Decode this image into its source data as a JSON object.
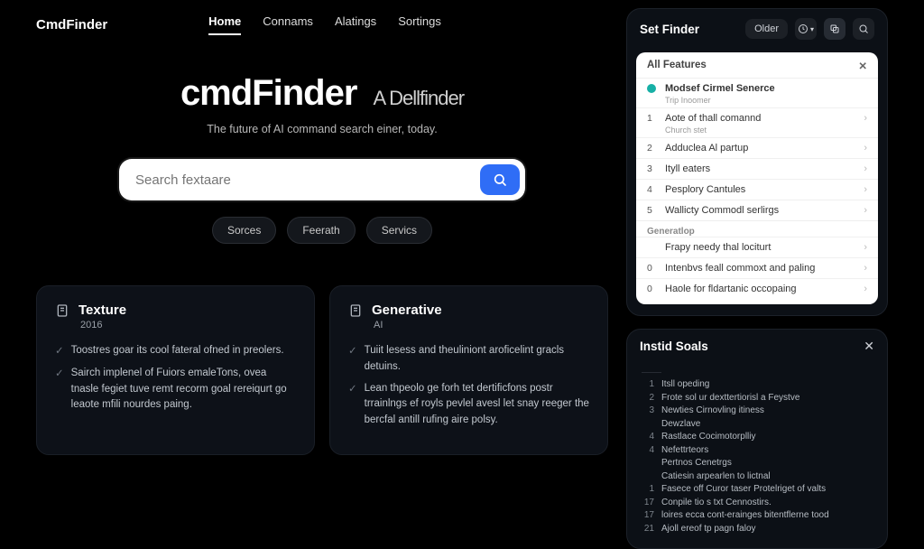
{
  "brand": "CmdFinder",
  "nav": {
    "items": [
      "Home",
      "Connams",
      "Alatings",
      "Sortings"
    ],
    "activeIndex": 0
  },
  "hero": {
    "title_main": "cmdFinder",
    "title_sub": "A Dellfinder",
    "tagline": "The future of AI command search einer, today."
  },
  "search": {
    "placeholder": "Search fextaare"
  },
  "chips": [
    "Sorces",
    "Feerath",
    "Servics"
  ],
  "cards": [
    {
      "title": "Texture",
      "sub": "2016",
      "items": [
        "Toostres goar its cool fateral ofned in preolers.",
        "Sairch implenel of Fuiors emaleTons, ovea tnasle fegiet tuve remt recorm goal rereiqurt go leaote mfili nourdes paing."
      ]
    },
    {
      "title": "Generative",
      "sub": "AI",
      "items": [
        "Tuiit lesess and theuliniont aroficelint gracls detuins.",
        "Lean thpeolo ge forh tet dertificfons postr trrainlngs ef royls pevlel avesl let snay reeger the bercfal antill rufing aire polsy."
      ]
    }
  ],
  "setFinder": {
    "title": "Set Finder",
    "olderLabel": "Older",
    "features": {
      "header": "All Features",
      "pinned": {
        "label": "Modsef Cirmel Senerce",
        "sub": "Trip Inoomer"
      },
      "list": [
        {
          "n": "1",
          "label": "Aote of thall comannd",
          "sub": "Church stet"
        },
        {
          "n": "2",
          "label": "Adduclea Al partup"
        },
        {
          "n": "3",
          "label": "Ityll eaters"
        },
        {
          "n": "4",
          "label": "Pesplory Cantules"
        },
        {
          "n": "5",
          "label": "Wallicty Commodl serlirgs"
        }
      ],
      "section": "Generatlop",
      "more": [
        {
          "n": "",
          "label": "Frapy needy thal lociturt"
        },
        {
          "n": "0",
          "label": "Intenbvs feall commoxt and paling"
        },
        {
          "n": "0",
          "label": "Haole for fldartanic occopaing"
        }
      ]
    }
  },
  "instid": {
    "title": "Instid Soals",
    "rows": [
      {
        "n": "1",
        "t": "Itsll opeding"
      },
      {
        "n": "2",
        "t": "Frote sol ur dexttertiorisl a Feystve"
      },
      {
        "n": "3",
        "t": "Newties Cirnovling itiness"
      },
      {
        "n": "",
        "t": "Dewzlave"
      },
      {
        "n": "4",
        "t": "Rastlace Cocimotorplliy"
      },
      {
        "n": "4",
        "t": "Nefettrteors"
      },
      {
        "n": "",
        "t": "Pertnos Cenetrgs"
      },
      {
        "n": "",
        "t": "Catiesin arpearlen to lictnal"
      },
      {
        "n": "1",
        "t": "Fasece off Curor taser Protelriget of valts"
      },
      {
        "n": "17",
        "t": "Conpile tio s txt Cennostirs."
      },
      {
        "n": "17",
        "t": "loires ecca cont-erainges bitentflerne tood"
      },
      {
        "n": "21",
        "t": "Ajoll ereof tp pagn faloy"
      }
    ]
  }
}
